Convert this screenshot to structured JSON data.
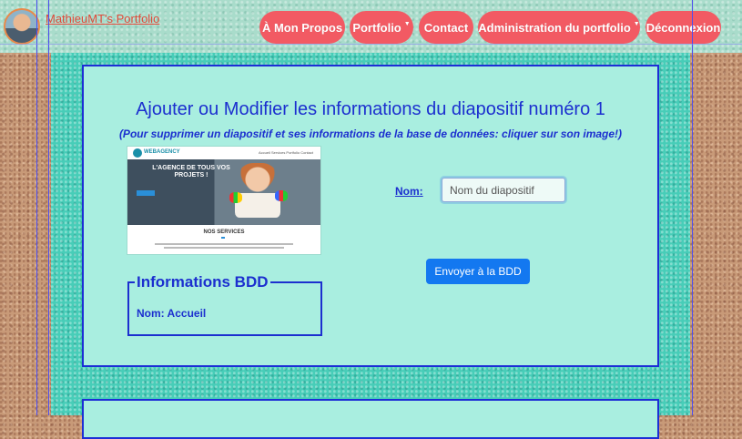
{
  "header": {
    "brand": "MathieuMT's Portfolio",
    "nav": [
      {
        "label": "À Mon Propos",
        "has_dropdown": false
      },
      {
        "label": "Portfolio",
        "has_dropdown": true
      },
      {
        "label": "Contact",
        "has_dropdown": false
      },
      {
        "label": "Administration du portfolio",
        "has_dropdown": true
      },
      {
        "label": "Déconnexion",
        "has_dropdown": false
      }
    ]
  },
  "main": {
    "title": "Ajouter ou Modifier les informations du diapositif numéro 1",
    "subtitle": "(Pour supprimer un diapositif et ses informations de la base de données: cliquer sur son image!)",
    "thumbnail": {
      "brand": "WEBAGENCY",
      "menu": "Accueil  Services  Portfolio  Contact",
      "headline": "L'AGENCE DE TOUS VOS PROJETS !",
      "services": "NOS SERVICES"
    },
    "info_box": {
      "legend": "Informations BDD",
      "value": "Nom: Accueil"
    },
    "form": {
      "nom_label": "Nom:",
      "nom_placeholder": "Nom du diapositif",
      "submit_label": "Envoyer à la BDD"
    }
  },
  "colors": {
    "nav_pill": "#f25a63",
    "panel_border": "#1d2ed6",
    "panel_bg": "#a9eee0",
    "accent_text": "#1c2fcf",
    "button": "#1378f0"
  },
  "icons": {
    "avatar": "user-avatar",
    "dropdown": "caret-down-icon"
  }
}
